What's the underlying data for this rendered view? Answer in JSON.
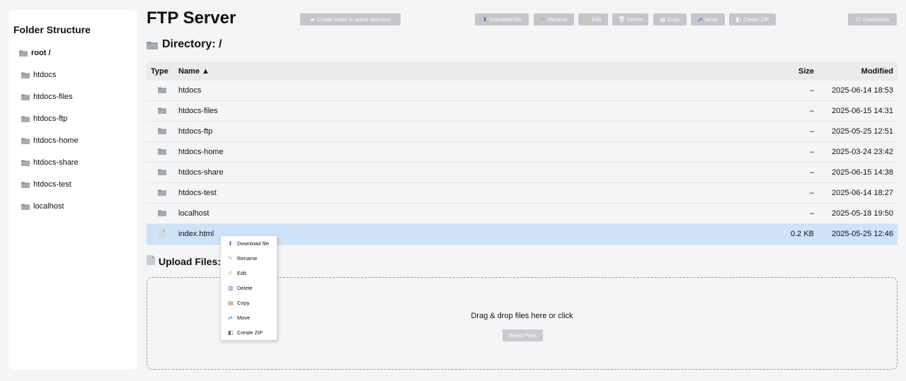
{
  "sidebar": {
    "title": "Folder Structure",
    "root_label": "root /",
    "items": [
      {
        "label": "htdocs"
      },
      {
        "label": "htdocs-files"
      },
      {
        "label": "htdocs-ftp"
      },
      {
        "label": "htdocs-home"
      },
      {
        "label": "htdocs-share"
      },
      {
        "label": "htdocs-test"
      },
      {
        "label": "localhost"
      }
    ]
  },
  "header": {
    "title": "FTP Server",
    "create_folder": "Create folder in active directory",
    "download": "Download file",
    "rename": "Rename",
    "edit": "Edit",
    "delete": "Delete",
    "copy": "Copy",
    "move": "Move",
    "create_zip": "Create ZIP",
    "disconnect": "Disconnect"
  },
  "directory": {
    "title": "Directory: /"
  },
  "table": {
    "col_type": "Type",
    "col_name": "Name ▲",
    "col_size": "Size",
    "col_modified": "Modified",
    "rows": [
      {
        "name": "htdocs",
        "size": "–",
        "modified": "2025-06-14 18:53",
        "kind": "folder"
      },
      {
        "name": "htdocs-files",
        "size": "–",
        "modified": "2025-06-15 14:31",
        "kind": "folder"
      },
      {
        "name": "htdocs-ftp",
        "size": "–",
        "modified": "2025-05-25 12:51",
        "kind": "folder"
      },
      {
        "name": "htdocs-home",
        "size": "–",
        "modified": "2025-03-24 23:42",
        "kind": "folder"
      },
      {
        "name": "htdocs-share",
        "size": "–",
        "modified": "2025-06-15 14:38",
        "kind": "folder"
      },
      {
        "name": "htdocs-test",
        "size": "–",
        "modified": "2025-06-14 18:27",
        "kind": "folder"
      },
      {
        "name": "localhost",
        "size": "–",
        "modified": "2025-05-18 19:50",
        "kind": "folder"
      },
      {
        "name": "index.html",
        "size": "0.2 KB",
        "modified": "2025-05-25 12:46",
        "kind": "file"
      }
    ]
  },
  "upload": {
    "title": "Upload Files:",
    "drop_text": "Drag & drop files here or click",
    "select_label": "Select Files"
  },
  "context_menu": {
    "items": [
      {
        "label": "Download file",
        "icon": "download-icon"
      },
      {
        "label": "Rename",
        "icon": "pencil-icon"
      },
      {
        "label": "Edit",
        "icon": "edit-icon"
      },
      {
        "label": "Delete",
        "icon": "trash-icon"
      },
      {
        "label": "Copy",
        "icon": "copy-icon"
      },
      {
        "label": "Move",
        "icon": "move-icon"
      },
      {
        "label": "Create ZIP",
        "icon": "zip-icon"
      }
    ]
  },
  "colors": {
    "selected_row": "#cde3f9",
    "button_disabled": "#c4c6c9"
  }
}
